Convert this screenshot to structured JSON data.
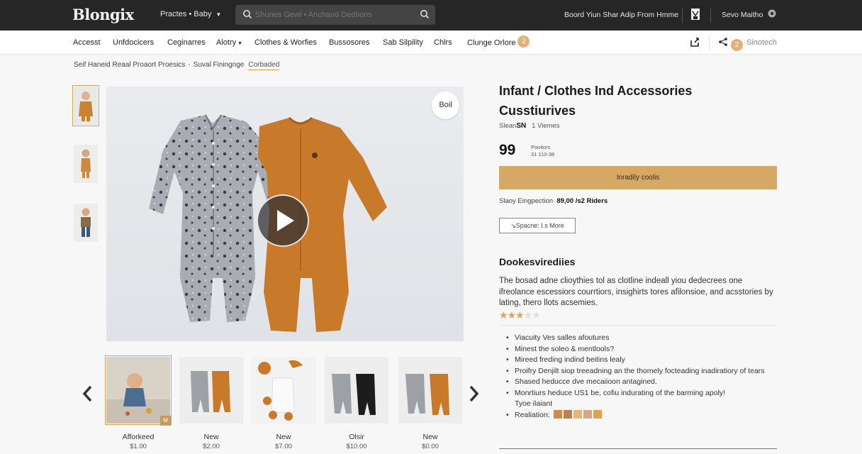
{
  "topbar": {
    "logo": "Blongix",
    "category": "Practes • Baby",
    "search_placeholder": "Shunes Gewl • Anchand Dedtions",
    "promo": "Boord Yiun Shar Adip From Hmme",
    "user": "Sevo Maitho"
  },
  "nav": {
    "items": [
      "Accesst",
      "Unfdocicers",
      "Ceginarres",
      "Alotry",
      "Clothes & Worfies",
      "Bussosores",
      "Sab Silpility",
      "Chlrs",
      "Clunge Orlore"
    ],
    "coin": "2",
    "coin2": "2",
    "right": "Sinotech"
  },
  "breadcrumb": {
    "path": "Seif Haneid Reaal Proaort Proesics",
    "sep": "-",
    "second": "Suval Finingnge",
    "current": "Corbaded"
  },
  "gallery": {
    "badge": "Boil",
    "thumbs": [
      {
        "caption": "Afforkeed",
        "price": "$1.00"
      },
      {
        "caption": "New",
        "price": "$2.00"
      },
      {
        "caption": "New",
        "price": "$7.00"
      },
      {
        "caption": "Olsir",
        "price": "$10.00"
      },
      {
        "caption": "New",
        "price": "$0.00"
      }
    ],
    "thumb_badge": "M"
  },
  "product": {
    "title_line1": "Infant / Clothes Ind Accessories",
    "title_line2": "Cusstiurives",
    "meta_label": "Slean",
    "meta_value": "SN",
    "meta_views": "1   Viemes",
    "price": "99",
    "price_note1": "Pooitors",
    "price_note2": "31 110-38",
    "cta": "Inradily coolis",
    "ship_label": "Slaoy Eingpection",
    "ship_value": "89,00 /s2 Riders",
    "more_button": "↘Spacne: I.s More",
    "section_title": "Dookesvirediies",
    "description": "The bosad adne clioythies tol as clotline indeall yiou dedecrees one ifreolance escessiors courrtiors, insighirts tores afilonsioe, and acsstories by lating, thero llots acsemies.",
    "rating": 3,
    "rating_max": 5,
    "bullets": [
      "Viacuity Ves salles afoutures",
      "Minest the soleo & mentlools?",
      "Mireed freding indind beitins lealy",
      "Proifry Denjilt siop treeadning an the thomely focteading inadiratiory of tears",
      "Shased heducce dve mecaiioon antagined.",
      "Monrtiurs heduce US1 be, cofiu indurating of the barming apoly!",
      "Tyoe ilaiant",
      "Realiation:"
    ],
    "swatches": [
      "#d18a3f",
      "#b8824a",
      "#e2b57c",
      "#cfa98a",
      "#e0a24f"
    ]
  },
  "colors": {
    "accent": "#d6a865",
    "topbar": "#262626"
  }
}
